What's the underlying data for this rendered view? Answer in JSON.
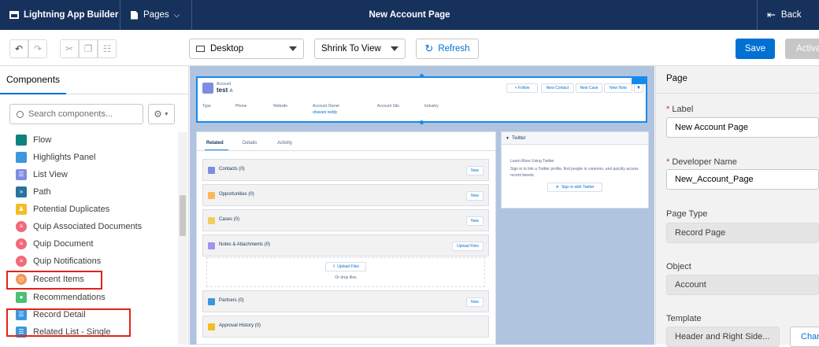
{
  "topbar": {
    "app_name": "Lightning App Builder",
    "pages_label": "Pages",
    "page_title": "New Account Page",
    "back_label": "Back"
  },
  "toolbar": {
    "device_select": "Desktop",
    "zoom_select": "Shrink To View",
    "refresh_label": "Refresh",
    "save_label": "Save",
    "activate_label": "Activa"
  },
  "components_panel": {
    "header": "Components",
    "search_placeholder": "Search components...",
    "items": [
      {
        "label": "Flow",
        "icon": "flow-icon",
        "color": "#0b827c"
      },
      {
        "label": "Highlights Panel",
        "icon": "highlights-panel-icon",
        "color": "#3c97dd"
      },
      {
        "label": "List View",
        "icon": "list-view-icon",
        "color": "#7f8de1"
      },
      {
        "label": "Path",
        "icon": "path-icon",
        "color": "#2a739e"
      },
      {
        "label": "Potential Duplicates",
        "icon": "potential-duplicates-icon",
        "color": "#f4bc25"
      },
      {
        "label": "Quip Associated Documents",
        "icon": "quip-icon",
        "color": "#f26979"
      },
      {
        "label": "Quip Document",
        "icon": "quip-document-icon",
        "color": "#f26979"
      },
      {
        "label": "Quip Notifications",
        "icon": "quip-notifications-icon",
        "color": "#f26979"
      },
      {
        "label": "Recent Items",
        "icon": "recent-items-icon",
        "color": "#f49756"
      },
      {
        "label": "Recommendations",
        "icon": "recommendations-icon",
        "color": "#4bc076"
      },
      {
        "label": "Record Detail",
        "icon": "record-detail-icon",
        "color": "#3c97dd"
      },
      {
        "label": "Related List - Single",
        "icon": "related-list-icon",
        "color": "#3c97dd"
      }
    ]
  },
  "canvas": {
    "highlights": {
      "object_label": "Account",
      "record_name": "test",
      "record_suffix": "A",
      "buttons": [
        "+ Follow",
        "New Contact",
        "New Case",
        "New Note"
      ],
      "fields": [
        "Type",
        "Phone",
        "Website",
        "Account Owner",
        "Account Site",
        "Industry"
      ],
      "owner_value": "shavani reddy"
    },
    "tabs": [
      "Related",
      "Details",
      "Activity"
    ],
    "related": [
      {
        "label": "Contacts (0)",
        "button": "New",
        "color": "#7f8de1"
      },
      {
        "label": "Opportunities (0)",
        "button": "New",
        "color": "#fcb95b"
      },
      {
        "label": "Cases (0)",
        "button": "New",
        "color": "#f2cf5b"
      },
      {
        "label": "Notes & Attachments (0)",
        "button": "Upload Files",
        "color": "#a094ed"
      },
      {
        "label": "Partners (0)",
        "button": "New",
        "color": "#3c97dd"
      },
      {
        "label": "Approval History (0)",
        "button": "",
        "color": "#f4bc25"
      }
    ],
    "upload": {
      "button": "Upload Files",
      "drop": "Or drop files"
    },
    "twitter": {
      "header": "Twitter",
      "title": "Learn More Using Twitter",
      "body": "Sign in to link a Twitter profile, find people in common, and quickly access recent tweets.",
      "button": "Sign in with Twitter"
    }
  },
  "properties": {
    "header": "Page",
    "label_label": "Label",
    "label_value": "New Account Page",
    "devname_label": "Developer Name",
    "devname_value": "New_Account_Page",
    "pagetype_label": "Page Type",
    "pagetype_value": "Record Page",
    "object_label": "Object",
    "object_value": "Account",
    "template_label": "Template",
    "template_value": "Header and Right Side...",
    "change_label": "Chan"
  }
}
